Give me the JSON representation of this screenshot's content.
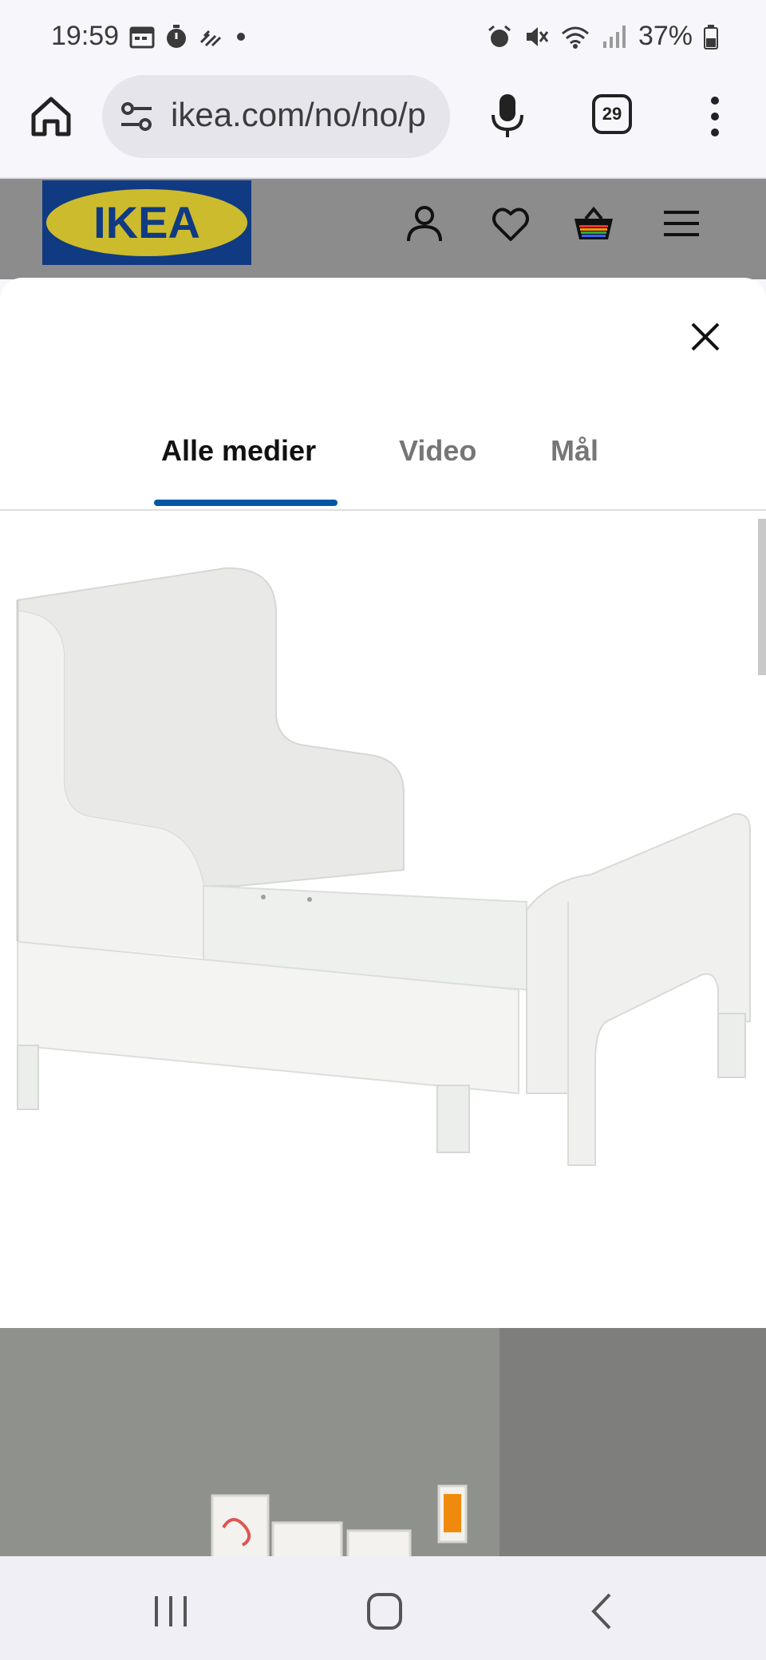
{
  "status_bar": {
    "time": "19:59",
    "battery": "37%"
  },
  "browser": {
    "url": "ikea.com/no/no/p",
    "tab_count": "29"
  },
  "header": {
    "logo_text": "IKEA"
  },
  "modal": {
    "tabs": [
      {
        "label": "Alle medier",
        "active": true
      },
      {
        "label": "Video",
        "active": false
      },
      {
        "label": "Mål",
        "active": false
      }
    ]
  },
  "colors": {
    "accent_blue": "#0058a3",
    "ikea_blue": "#0058a3",
    "ikea_yellow": "#ffdb00"
  },
  "icons": [
    "home-icon",
    "site-settings-icon",
    "mic-icon",
    "more-vert-icon",
    "account-icon",
    "heart-icon",
    "basket-icon",
    "hamburger-icon",
    "close-icon",
    "recents-icon",
    "home-circle-icon",
    "back-icon"
  ]
}
